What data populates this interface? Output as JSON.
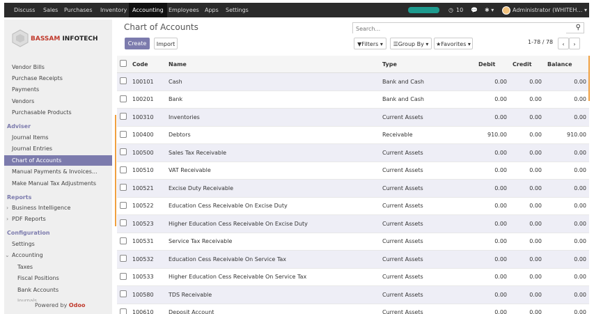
{
  "nav": {
    "apps": [
      "Discuss",
      "Sales",
      "Purchases",
      "Inventory",
      "Accounting",
      "Employees",
      "Apps",
      "Settings"
    ],
    "active": "Accounting",
    "progress": 1.0,
    "messages_count": "10",
    "user": "Administrator (WHITEH…"
  },
  "logo": {
    "brand": "BASSAM",
    "suffix": " INFOTECH"
  },
  "sidebar": {
    "items_top": [
      "Vendor Bills",
      "Purchase Receipts",
      "Payments",
      "Vendors",
      "Purchasable Products"
    ],
    "adviser_head": "Adviser",
    "adviser_items": [
      "Journal Items",
      "Journal Entries",
      "Chart of Accounts",
      "Manual Payments & Invoices…",
      "Make Manual Tax Adjustments"
    ],
    "reports_head": "Reports",
    "reports_items": [
      "Business Intelligence",
      "PDF Reports"
    ],
    "config_head": "Configuration",
    "config_items": [
      "Settings",
      "Accounting"
    ],
    "config_sub": [
      "Taxes",
      "Fiscal Positions",
      "Bank Accounts",
      "Journals"
    ],
    "powered_by": "Powered by",
    "powered_brand": "Odoo"
  },
  "header": {
    "title": "Chart of Accounts",
    "create_label": "Create",
    "import_label": "Import",
    "search_placeholder": "Search...",
    "filters_label": "Filters",
    "groupby_label": "Group By",
    "favorites_label": "Favorites",
    "pager": "1-78 / 78"
  },
  "table": {
    "columns": [
      "Code",
      "Name",
      "Type",
      "Debit",
      "Credit",
      "Balance"
    ],
    "rows": [
      [
        "100101",
        "Cash",
        "Bank and Cash",
        "0.00",
        "0.00",
        "0.00"
      ],
      [
        "100201",
        "Bank",
        "Bank and Cash",
        "0.00",
        "0.00",
        "0.00"
      ],
      [
        "100310",
        "Inventories",
        "Current Assets",
        "0.00",
        "0.00",
        "0.00"
      ],
      [
        "100400",
        "Debtors",
        "Receivable",
        "910.00",
        "0.00",
        "910.00"
      ],
      [
        "100500",
        "Sales Tax Receivable",
        "Current Assets",
        "0.00",
        "0.00",
        "0.00"
      ],
      [
        "100510",
        "VAT Receivable",
        "Current Assets",
        "0.00",
        "0.00",
        "0.00"
      ],
      [
        "100521",
        "Excise Duty Receivable",
        "Current Assets",
        "0.00",
        "0.00",
        "0.00"
      ],
      [
        "100522",
        "Education Cess Receivable On Excise Duty",
        "Current Assets",
        "0.00",
        "0.00",
        "0.00"
      ],
      [
        "100523",
        "Higher Education Cess Receivable On Excise Duty",
        "Current Assets",
        "0.00",
        "0.00",
        "0.00"
      ],
      [
        "100531",
        "Service Tax Receivable",
        "Current Assets",
        "0.00",
        "0.00",
        "0.00"
      ],
      [
        "100532",
        "Education Cess Receivable On Service Tax",
        "Current Assets",
        "0.00",
        "0.00",
        "0.00"
      ],
      [
        "100533",
        "Higher Education Cess Receivable On Service Tax",
        "Current Assets",
        "0.00",
        "0.00",
        "0.00"
      ],
      [
        "100580",
        "TDS Receivable",
        "Current Assets",
        "0.00",
        "0.00",
        "0.00"
      ],
      [
        "100610",
        "Deposit Account",
        "Current Assets",
        "0.00",
        "0.00",
        "0.00"
      ]
    ]
  }
}
